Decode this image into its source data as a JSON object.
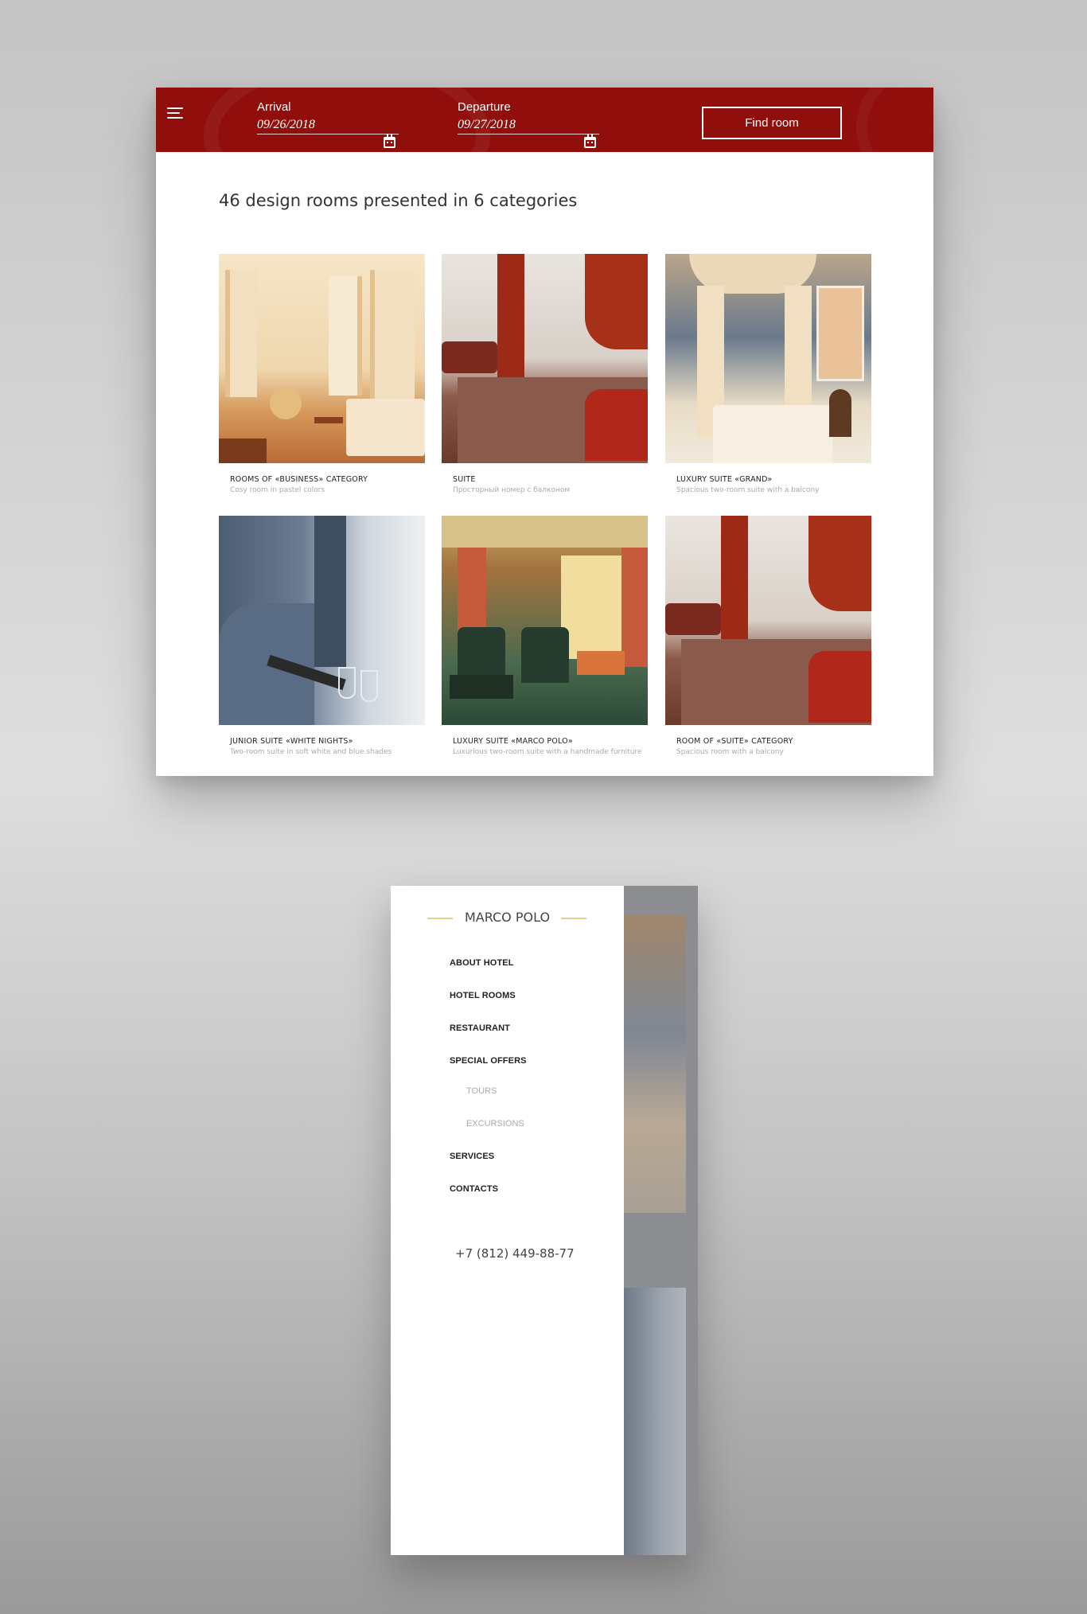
{
  "booking": {
    "arrival_label": "Arrival",
    "arrival_value": "09/26/2018",
    "departure_label": "Departure",
    "departure_value": "09/27/2018",
    "find_button": "Find room"
  },
  "headline": "46 design rooms presented in 6 categories",
  "rooms": [
    {
      "name": "ROOMS OF «BUSINESS» CATEGORY",
      "desc": "Cosy room in pastel colors"
    },
    {
      "name": "SUITE",
      "desc": "Просторный номер с балконом"
    },
    {
      "name": "LUXURY SUITE «GRAND»",
      "desc": "Spacious two-room suite with a balcony"
    },
    {
      "name": "JUNIOR SUITE «WHITE NIGHTS»",
      "desc": "Two-room suite in soft white and blue shades"
    },
    {
      "name": "LUXURY SUITE «MARCO POLO»",
      "desc": "Luxurious two-room suite with a handmade furniture"
    },
    {
      "name": "ROOM OF «SUITE» CATEGORY",
      "desc": "Spacious room with a balcony"
    }
  ],
  "menu": {
    "brand": "MARCO POLO",
    "items": [
      {
        "label": "ABOUT HOTEL"
      },
      {
        "label": "HOTEL ROOMS"
      },
      {
        "label": "RESTAURANT"
      },
      {
        "label": "SPECIAL OFFERS"
      },
      {
        "label": "TOURS"
      },
      {
        "label": "EXCURSIONS"
      },
      {
        "label": "SERVICES"
      },
      {
        "label": "CONTACTS"
      }
    ],
    "phone": "+7 (812) 449-88-77"
  },
  "colors": {
    "brand_red": "#900f0c",
    "accent_gold": "#e8cf8a"
  },
  "icons": [
    "menu-icon",
    "calendar-icon"
  ]
}
